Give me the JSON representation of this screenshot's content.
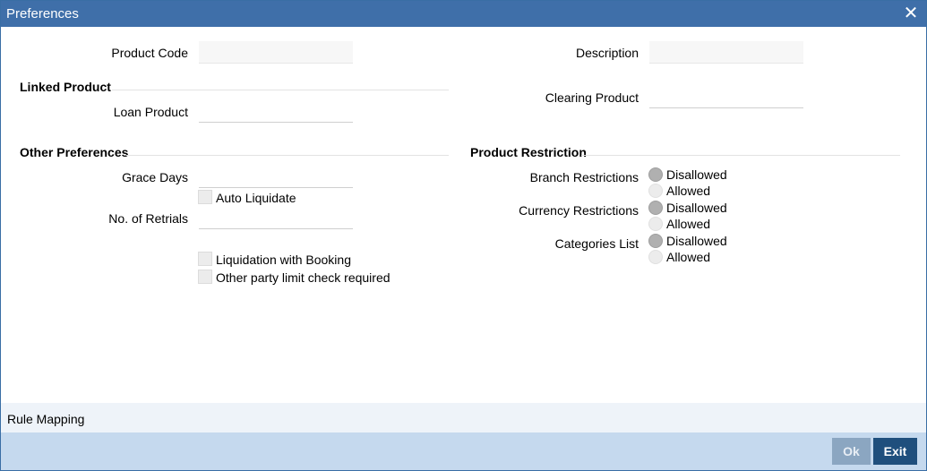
{
  "window": {
    "title": "Preferences",
    "close_icon": "close-icon"
  },
  "product_code": {
    "label": "Product Code",
    "value": ""
  },
  "description": {
    "label": "Description",
    "value": ""
  },
  "linked_product": {
    "heading": "Linked Product",
    "loan_product": {
      "label": "Loan Product",
      "value": ""
    }
  },
  "clearing_product": {
    "label": "Clearing Product",
    "value": ""
  },
  "other_preferences": {
    "heading": "Other Preferences",
    "grace_days": {
      "label": "Grace Days",
      "value": ""
    },
    "auto_liquidate": {
      "label": "Auto Liquidate",
      "checked": false
    },
    "no_of_retrials": {
      "label": "No. of Retrials",
      "value": ""
    },
    "liquidation_with_booking": {
      "label": "Liquidation with Booking",
      "checked": false
    },
    "other_party_limit_check": {
      "label": "Other party limit check required",
      "checked": false
    }
  },
  "product_restriction": {
    "heading": "Product Restriction",
    "branch": {
      "label": "Branch Restrictions",
      "options": [
        "Disallowed",
        "Allowed"
      ],
      "selected": "Disallowed"
    },
    "currency": {
      "label": "Currency Restrictions",
      "options": [
        "Disallowed",
        "Allowed"
      ],
      "selected": "Disallowed"
    },
    "categories": {
      "label": "Categories List",
      "options": [
        "Disallowed",
        "Allowed"
      ],
      "selected": "Disallowed"
    }
  },
  "rule_mapping": {
    "label": "Rule Mapping"
  },
  "footer": {
    "ok_label": "Ok",
    "exit_label": "Exit"
  },
  "colors": {
    "titlebar": "#3f6fa9",
    "footer": "#c5d9ee",
    "exit_button": "#1f4f7d",
    "ok_button": "#8ba6c1"
  }
}
